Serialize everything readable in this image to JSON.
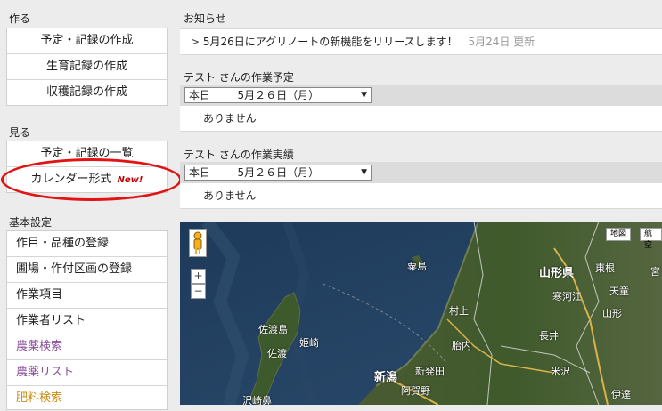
{
  "left": {
    "create": {
      "label": "作る",
      "items": [
        "予定・記録の作成",
        "生育記録の作成",
        "収穫記録の作成"
      ]
    },
    "view": {
      "label": "見る",
      "items": [
        "予定・記録の一覧",
        "カレンダー形式"
      ],
      "new_badge": "New!"
    },
    "settings": {
      "label": "基本設定",
      "items": [
        "作目・品種の登録",
        "圃場・作付区画の登録",
        "作業項目",
        "作業者リスト"
      ],
      "links": [
        "農薬検索",
        "農薬リスト",
        "肥料検索"
      ]
    }
  },
  "right": {
    "notice": {
      "label": "お知らせ",
      "text": "5月26日にアグリノートの新機能をリリースします！",
      "date": "5月24日 更新"
    },
    "plan": {
      "label": "テスト さんの作業予定",
      "select_value": "本日        5月２６日（月）",
      "empty": "ありません"
    },
    "record": {
      "label": "テスト さんの作業実績",
      "select_value": "本日        5月２６日（月）",
      "empty": "ありません"
    }
  },
  "map": {
    "buttons": [
      "地図",
      "航空"
    ],
    "zoom_in": "+",
    "zoom_out": "−",
    "places": [
      "粟島",
      "山形県",
      "東根",
      "寒河江",
      "天童",
      "山形",
      "村上",
      "佐渡島",
      "姫崎",
      "佐渡",
      "胎内",
      "新潟",
      "新発田",
      "長井",
      "阿賀野",
      "米沢",
      "沢崎鼻",
      "伊達",
      "宮"
    ]
  }
}
